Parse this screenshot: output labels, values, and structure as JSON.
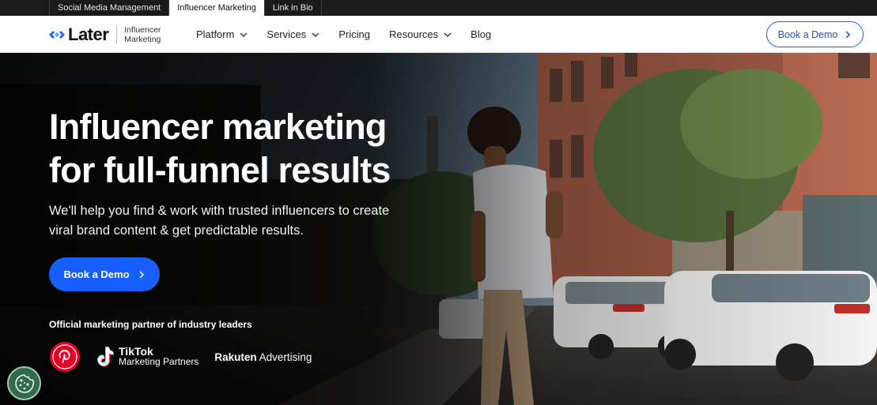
{
  "topbar": {
    "tabs": [
      {
        "label": "Social Media Management"
      },
      {
        "label": "Influencer Marketing"
      },
      {
        "label": "Link in Bio"
      }
    ]
  },
  "header": {
    "logo_text": "Later",
    "logo_sub_1": "Influencer",
    "logo_sub_2": "Marketing",
    "nav": [
      {
        "label": "Platform"
      },
      {
        "label": "Services"
      },
      {
        "label": "Pricing"
      },
      {
        "label": "Resources"
      },
      {
        "label": "Blog"
      }
    ],
    "cta_label": "Book a Demo"
  },
  "hero": {
    "title_line_1": "Influencer marketing",
    "title_line_2": "for full-funnel results",
    "subtitle_line_1": "We'll help you find & work with trusted influencers to create",
    "subtitle_line_2": "viral brand content & get predictable results.",
    "cta_label": "Book a Demo",
    "partner_heading": "Official marketing partner of industry leaders",
    "partners": {
      "tiktok_name": "TikTok",
      "tiktok_sub": "Marketing Partners",
      "rakuten_bold": "Rakuten",
      "rakuten_rest": " Advertising"
    }
  },
  "icons": {
    "logo": "later-logo-mark",
    "chevron": "chevron-down-icon",
    "arrow": "chevron-right-icon",
    "pinterest": "pinterest-partner-badge",
    "tiktok": "tiktok-icon",
    "cookie": "cookie-icon"
  },
  "colors": {
    "brand_blue": "#1760ff",
    "topbar": "#1b1b1b",
    "cookie_green": "#2f6b4c",
    "pinterest_red": "#e60023"
  }
}
